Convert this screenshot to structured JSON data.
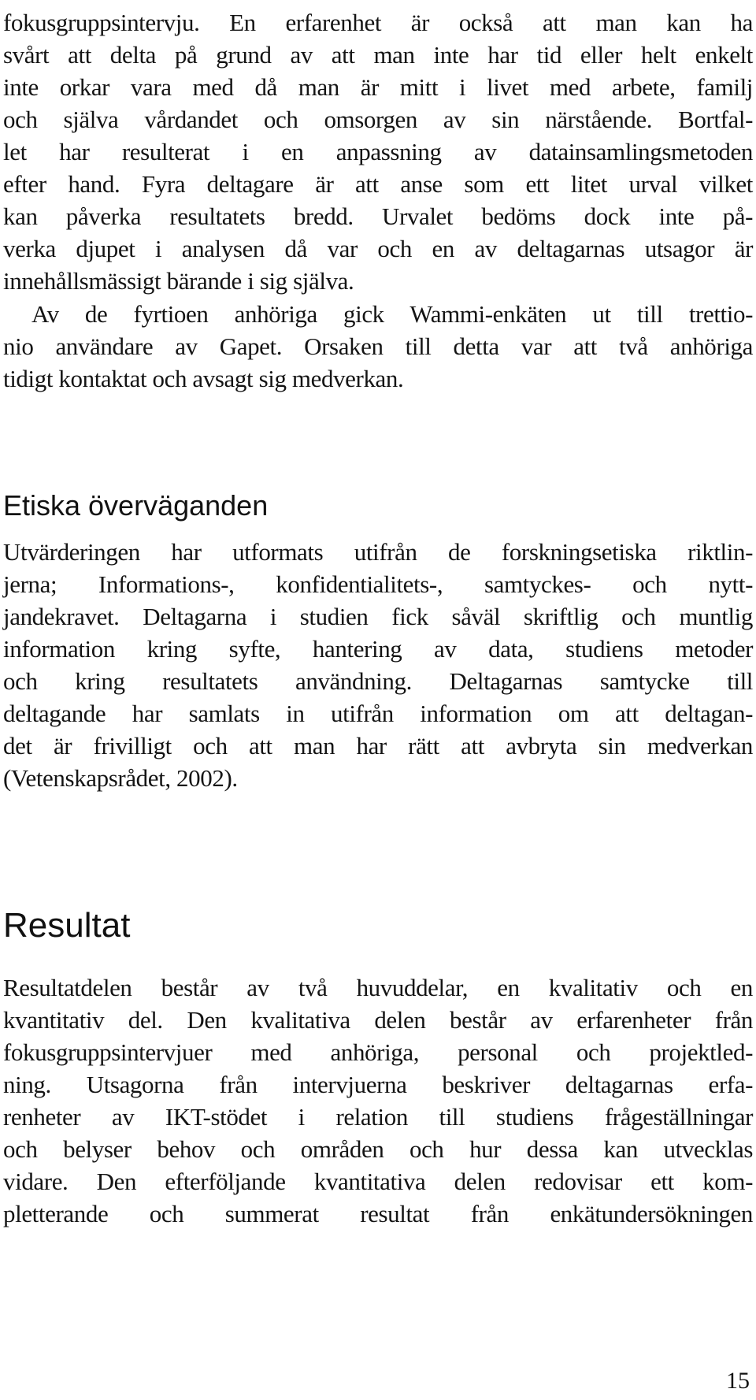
{
  "document": {
    "intro_paragraph": {
      "lines": [
        "fokusgruppsintervju. En erfarenhet är också att man kan ha",
        "svårt att delta på grund av att man inte har tid eller helt enkelt",
        "inte orkar vara med då man är mitt i livet med arbete, familj",
        "och själva vårdandet och omsorgen av sin närstående. Bortfal-",
        "let har resulterat i en anpassning av datainsamlingsmetoden",
        "efter hand. Fyra deltagare är att anse som ett litet urval vilket",
        "kan påverka resultatets bredd. Urvalet bedöms dock inte på-",
        "verka djupet i analysen då var och en av deltagarnas utsagor är",
        "innehållsmässigt bärande i sig själva."
      ]
    },
    "survey_paragraph": {
      "lines": [
        "Av de fyrtioen anhöriga gick Wammi-enkäten ut till trettio-",
        "nio användare av Gapet. Orsaken till detta var att två anhöriga",
        "tidigt kontaktat och avsagt sig medverkan."
      ]
    },
    "ethics_section": {
      "heading": "Etiska överväganden",
      "lines": [
        "Utvärderingen har utformats utifrån de forskningsetiska riktlin-",
        "jerna; Informations-, konfidentialitets-, samtyckes- och nytt-",
        "jandekravet. Deltagarna i studien fick såväl skriftlig och muntlig",
        "information kring syfte, hantering av data, studiens metoder",
        "och kring resultatets användning. Deltagarnas samtycke till",
        "deltagande har samlats in utifrån information om att deltagan-",
        "det är frivilligt och att man har rätt att avbryta sin medverkan",
        "(Vetenskapsrådet, 2002)."
      ]
    },
    "results_section": {
      "heading": "Resultat",
      "lines": [
        "Resultatdelen består av två huvuddelar, en kvalitativ och en",
        "kvantitativ del. Den kvalitativa delen består av erfarenheter från",
        "fokusgruppsintervjuer med anhöriga, personal och projektled-",
        "ning. Utsagorna från intervjuerna beskriver deltagarnas erfa-",
        "renheter av IKT-stödet i relation till studiens frågeställningar",
        "och belyser behov och områden och hur dessa kan utvecklas",
        "vidare. Den efterföljande kvantitativa delen redovisar ett kom-",
        "pletterande och summerat resultat från enkätundersökningen"
      ]
    },
    "page_number": "15"
  }
}
